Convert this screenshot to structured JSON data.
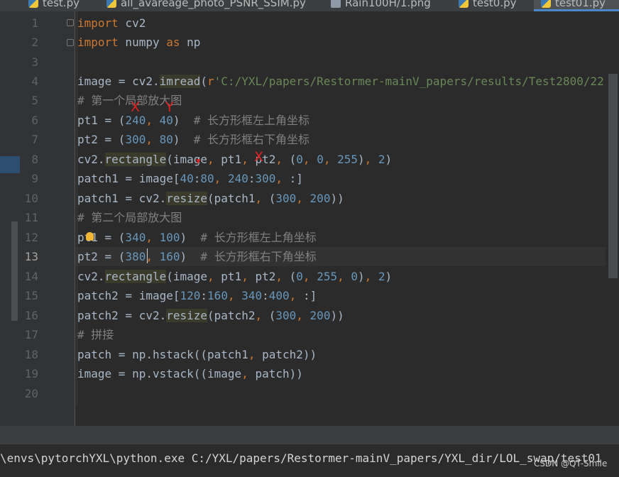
{
  "tabs": [
    {
      "label": "test.py",
      "icon": "python-file-icon",
      "active": false
    },
    {
      "label": "all_avareage_photo_PSNR_SSIM.py",
      "icon": "python-file-icon",
      "active": false
    },
    {
      "label": "Rain100H/1.png",
      "icon": "image-file-icon",
      "active": false
    },
    {
      "label": "test0.py",
      "icon": "python-file-icon",
      "active": false
    },
    {
      "label": "test01.py",
      "icon": "python-file-icon",
      "active": true
    }
  ],
  "line_numbers": [
    "1",
    "2",
    "3",
    "4",
    "5",
    "6",
    "7",
    "8",
    "9",
    "10",
    "11",
    "12",
    "13",
    "14",
    "15",
    "16",
    "17",
    "18",
    "19",
    "20"
  ],
  "current_line": 13,
  "code": {
    "l1_kw": "import",
    "l1_rest": " cv2",
    "l2_kw": "import",
    "l2_mod": " numpy ",
    "l2_as": "as",
    "l2_alias": " np",
    "l4_a": "image = cv2.",
    "l4_fn": "imread",
    "l4_p": "(",
    "l4_r": "r",
    "l4_str": "'C:/YXL/papers/Restormer-mainV_papers/results/Test2800/22",
    "l5_cmt": "# 第一个局部放大图",
    "l6_a": "pt1 = (",
    "l6_n1": "240",
    "l6_c": ", ",
    "l6_n2": "40",
    "l6_b": ")  ",
    "l6_cmt": "# 长方形框左上角坐标",
    "l7_a": "pt2 = (",
    "l7_n1": "300",
    "l7_c": ", ",
    "l7_n2": "80",
    "l7_b": ")  ",
    "l7_cmt": "# 长方形框右下角坐标",
    "l8_a": "cv2.",
    "l8_fn": "rectangle",
    "l8_b": "(image",
    "l8_c1": ", ",
    "l8_d": "pt1",
    "l8_c2": ", ",
    "l8_e": "pt2",
    "l8_c3": ", ",
    "l8_f": "(",
    "l8_n1": "0",
    "l8_c4": ", ",
    "l8_n2": "0",
    "l8_c5": ", ",
    "l8_n3": "255",
    "l8_g": ")",
    "l8_c6": ", ",
    "l8_n4": "2",
    "l8_h": ")",
    "l9_a": "patch1 = image[",
    "l9_n1": "40",
    "l9_b": ":",
    "l9_n2": "80",
    "l9_c": ", ",
    "l9_n3": "240",
    "l9_d": ":",
    "l9_n4": "300",
    "l9_e": ", ",
    "l9_f": ":]",
    "l10_a": "patch1 = cv2.",
    "l10_fn": "resize",
    "l10_b": "(patch1",
    "l10_c": ", ",
    "l10_d": "(",
    "l10_n1": "300",
    "l10_e": ", ",
    "l10_n2": "200",
    "l10_f": "))",
    "l11_cmt": "# 第二个局部放大图",
    "l12_a": "pt1 = (",
    "l12_n1": "340",
    "l12_c": ", ",
    "l12_n2": "100",
    "l12_b": ")  ",
    "l12_cmt": "# 长方形框左上角坐标",
    "l13_a": "pt2 = (",
    "l13_n1": "380",
    "l13_c": ", ",
    "l13_n2": "160",
    "l13_b": ")  ",
    "l13_cmt": "# 长方形框右下角坐标",
    "l14_a": "cv2.",
    "l14_fn": "rectangle",
    "l14_b": "(image",
    "l14_c1": ", ",
    "l14_d": "pt1",
    "l14_c2": ", ",
    "l14_e": "pt2",
    "l14_c3": ", ",
    "l14_f": "(",
    "l14_n1": "0",
    "l14_c4": ", ",
    "l14_n2": "255",
    "l14_c5": ", ",
    "l14_n3": "0",
    "l14_g": ")",
    "l14_c6": ", ",
    "l14_n4": "2",
    "l14_h": ")",
    "l15_a": "patch2 = image[",
    "l15_n1": "120",
    "l15_b": ":",
    "l15_n2": "160",
    "l15_c": ", ",
    "l15_n3": "340",
    "l15_d": ":",
    "l15_n4": "400",
    "l15_e": ", ",
    "l15_f": ":]",
    "l16_a": "patch2 = cv2.",
    "l16_fn": "resize",
    "l16_b": "(patch2",
    "l16_c": ", ",
    "l16_d": "(",
    "l16_n1": "300",
    "l16_e": ", ",
    "l16_n2": "200",
    "l16_f": "))",
    "l17_cmt": "# 拼接",
    "l18_a": "patch = np.hstack((patch1",
    "l18_c": ", ",
    "l18_b": "patch2))",
    "l19_a": "image = np.vstack((image",
    "l19_c": ", ",
    "l19_b": "patch))"
  },
  "annotations": {
    "mark_x": "X",
    "mark_y": "Y",
    "mark_x2": "X",
    "mark_dot": "▾"
  },
  "console": {
    "command": "\\envs\\pytorchYXL\\python.exe C:/YXL/papers/Restormer-mainV_papers/YXL_dir/LOL_swap/test01"
  },
  "watermark": "CSDN @QT-Smile",
  "colors": {
    "keyword": "#cc7832",
    "number": "#6897bb",
    "string": "#6a8759",
    "comment": "#808080",
    "text": "#a9b7c6",
    "background": "#2b2b2b"
  }
}
